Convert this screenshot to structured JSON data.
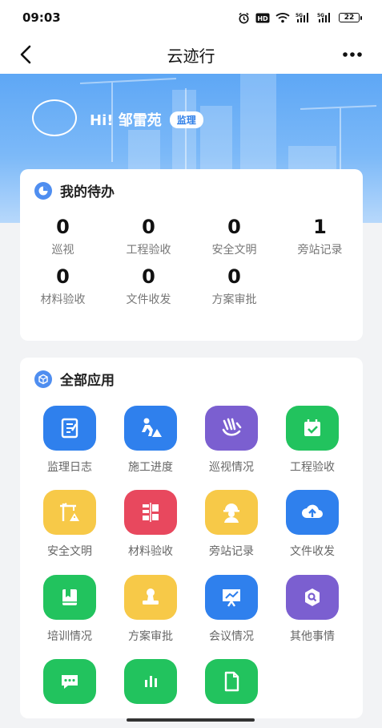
{
  "status_bar": {
    "time": "09:03",
    "battery": "22"
  },
  "nav": {
    "title": "云迹行"
  },
  "profile": {
    "greeting": "Hi! 邹雷苑",
    "role": "监理"
  },
  "todo": {
    "title": "我的待办",
    "items": [
      {
        "count": "0",
        "label": "巡视"
      },
      {
        "count": "0",
        "label": "工程验收"
      },
      {
        "count": "0",
        "label": "安全文明"
      },
      {
        "count": "1",
        "label": "旁站记录"
      },
      {
        "count": "0",
        "label": "材料验收"
      },
      {
        "count": "0",
        "label": "文件收发"
      },
      {
        "count": "0",
        "label": "方案审批"
      }
    ]
  },
  "apps": {
    "title": "全部应用",
    "items": [
      {
        "label": "监理日志",
        "icon": "notebook-icon",
        "color": "#2f80ed"
      },
      {
        "label": "施工进度",
        "icon": "construction-worker-icon",
        "color": "#2f80ed"
      },
      {
        "label": "巡视情况",
        "icon": "wave-hand-icon",
        "color": "#7b5fd0"
      },
      {
        "label": "工程验收",
        "icon": "calendar-check-icon",
        "color": "#22c35e"
      },
      {
        "label": "安全文明",
        "icon": "crane-warning-icon",
        "color": "#f7c948"
      },
      {
        "label": "材料验收",
        "icon": "material-grid-icon",
        "color": "#e8485e"
      },
      {
        "label": "旁站记录",
        "icon": "hardhat-worker-icon",
        "color": "#f7c948"
      },
      {
        "label": "文件收发",
        "icon": "cloud-upload-icon",
        "color": "#2f80ed"
      },
      {
        "label": "培训情况",
        "icon": "book-icon",
        "color": "#22c35e"
      },
      {
        "label": "方案审批",
        "icon": "stamp-icon",
        "color": "#f7c948"
      },
      {
        "label": "会议情况",
        "icon": "presentation-icon",
        "color": "#2f80ed"
      },
      {
        "label": "其他事情",
        "icon": "search-bubble-icon",
        "color": "#7b5fd0"
      },
      {
        "label": "",
        "icon": "chat-bubble-icon",
        "color": "#22c35e"
      },
      {
        "label": "",
        "icon": "bar-chart-icon",
        "color": "#22c35e"
      },
      {
        "label": "",
        "icon": "document-icon",
        "color": "#22c35e"
      }
    ]
  }
}
